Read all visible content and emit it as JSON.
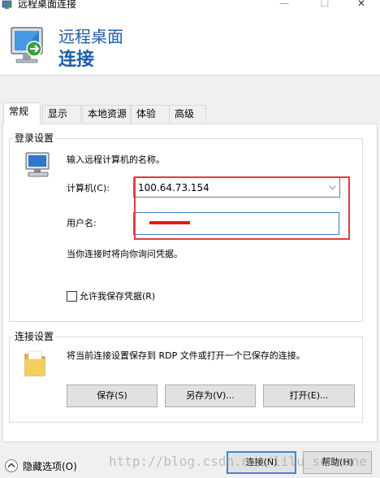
{
  "window": {
    "title": "远程桌面连接",
    "minimize": "—",
    "maximize": "☐",
    "close": "✕"
  },
  "banner": {
    "line1": "远程桌面",
    "line2": "连接"
  },
  "tabs": [
    {
      "label": "常规",
      "active": true
    },
    {
      "label": "显示"
    },
    {
      "label": "本地资源"
    },
    {
      "label": "体验"
    },
    {
      "label": "高级"
    }
  ],
  "login": {
    "group_label": "登录设置",
    "instruction": "输入远程计算机的名称。",
    "computer_label": "计算机(C):",
    "computer_value": "100.64.73.154",
    "username_label": "用户名:",
    "username_value": "",
    "prompt_note": "当你连接时将向你询问凭据。",
    "save_credentials_label": "允许我保存凭据(R)",
    "save_credentials_checked": false
  },
  "connection": {
    "group_label": "连接设置",
    "description": "将当前连接设置保存到 RDP 文件或打开一个已保存的连接。",
    "save_button": "保存(S)",
    "save_as_button": "另存为(V)...",
    "open_button": "打开(E)..."
  },
  "footer": {
    "hide_options": "隐藏选项(O)",
    "connect_button": "连接(N)",
    "help_button": "帮助(H)",
    "watermark": "http://blog.csdn.net/lilu_someone"
  },
  "colors": {
    "brand_blue": "#1d5ea8",
    "annotation_red": "#e53a3a",
    "primary_border": "#3b86d6"
  }
}
